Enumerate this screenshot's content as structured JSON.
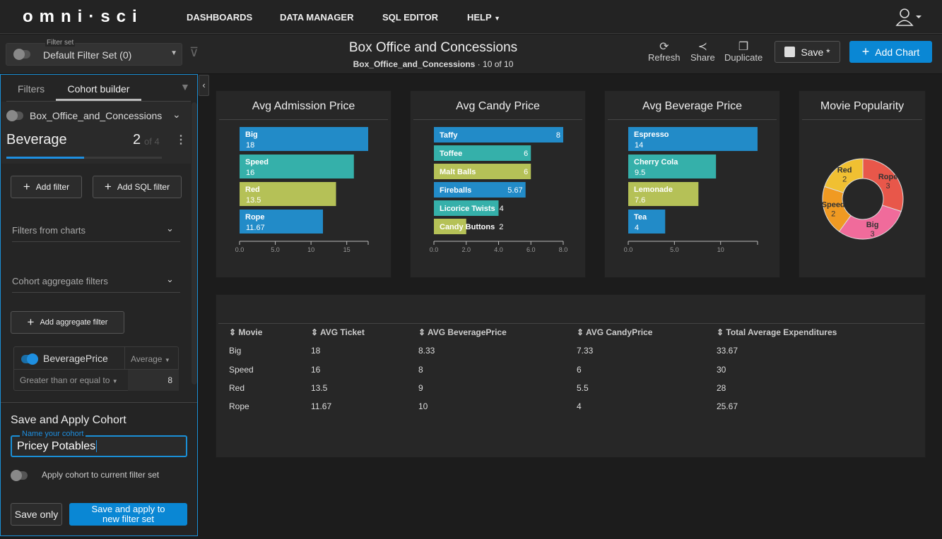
{
  "nav": {
    "logo": "omni·sci",
    "items": [
      "DASHBOARDS",
      "DATA MANAGER",
      "SQL EDITOR",
      "HELP"
    ],
    "user_icon": "user-icon"
  },
  "subheader": {
    "filter_set_label": "Filter set",
    "filter_set_value": "Default Filter Set (0)",
    "title": "Box Office and Concessions",
    "source": "Box_Office_and_Concessions",
    "count": "10 of 10",
    "refresh": "Refresh",
    "share": "Share",
    "duplicate": "Duplicate",
    "save": "Save *",
    "add_chart": "Add Chart"
  },
  "left": {
    "tabs": [
      "Filters",
      "Cohort builder"
    ],
    "active_tab": "Cohort builder",
    "table": "Box_Office_and_Concessions",
    "cohort": "Beverage",
    "index": "2",
    "of": "of 4",
    "progress": 0.5,
    "add_filter": "Add filter",
    "add_sql_filter": "Add SQL filter",
    "filters_from_charts": "Filters from charts",
    "cohort_aggregate_filters": "Cohort aggregate filters",
    "add_aggregate_filter": "Add aggregate filter",
    "agg": {
      "field": "BeveragePrice",
      "enabled": true,
      "agg": "Average",
      "op": "Greater than or equal to",
      "value": "8"
    },
    "save_title": "Save and Apply Cohort",
    "name_label": "Name your cohort",
    "name_value": "Pricey Potables",
    "apply_label": "Apply cohort to current filter set",
    "save_only": "Save only",
    "save_apply": "Save and apply to new filter set"
  },
  "colors": {
    "accent": "#0a87d4",
    "blue": "#228bc8",
    "teal": "#35b0aa",
    "olive": "#b5c157"
  },
  "chart_data": [
    {
      "type": "bar",
      "title": "Avg Admission Price",
      "categories": [
        "Big",
        "Speed",
        "Red",
        "Rope"
      ],
      "values": [
        18,
        16,
        13.5,
        11.67
      ],
      "labels": [
        "18",
        "16",
        "13.5",
        "11.67"
      ],
      "xticks": [
        "0.0",
        "5.0",
        "10",
        "15"
      ],
      "tickvals": [
        0,
        5,
        10,
        15
      ],
      "xlim": [
        0,
        18
      ],
      "colors": [
        "#228bc8",
        "#35b0aa",
        "#b5c157",
        "#228bc8"
      ]
    },
    {
      "type": "bar",
      "title": "Avg Candy Price",
      "categories": [
        "Taffy",
        "Toffee",
        "Malt Balls",
        "Fireballs",
        "Licorice Twists",
        "Candy Buttons"
      ],
      "values": [
        8,
        6,
        6,
        5.67,
        4,
        2
      ],
      "labels": [
        "8",
        "6",
        "6",
        "5.67",
        "4",
        "2"
      ],
      "xticks": [
        "0.0",
        "2.0",
        "4.0",
        "6.0",
        "8.0"
      ],
      "tickvals": [
        0,
        2,
        4,
        6,
        8
      ],
      "xlim": [
        0,
        8
      ],
      "colors": [
        "#228bc8",
        "#35b0aa",
        "#b5c157",
        "#228bc8",
        "#35b0aa",
        "#b5c157"
      ]
    },
    {
      "type": "bar",
      "title": "Avg Beverage Price",
      "categories": [
        "Espresso",
        "Cherry Cola",
        "Lemonade",
        "Tea"
      ],
      "values": [
        14,
        9.5,
        7.6,
        4
      ],
      "labels": [
        "14",
        "9.5",
        "7.6",
        "4"
      ],
      "xticks": [
        "0.0",
        "5.0",
        "10"
      ],
      "tickvals": [
        0,
        5,
        10
      ],
      "xlim": [
        0,
        14
      ],
      "colors": [
        "#228bc8",
        "#35b0aa",
        "#b5c157",
        "#228bc8"
      ]
    },
    {
      "type": "pie",
      "title": "Movie Popularity",
      "categories": [
        "Rope",
        "Big",
        "Speed",
        "Red"
      ],
      "values": [
        3,
        3,
        2,
        2
      ],
      "colors": [
        "#e8574a",
        "#f06b9b",
        "#f09a22",
        "#f0c032"
      ]
    }
  ],
  "table": {
    "columns": [
      "Movie",
      "AVG Ticket",
      "AVG BeveragePrice",
      "AVG CandyPrice",
      "Total Average Expenditures"
    ],
    "rows": [
      [
        "Big",
        "18",
        "8.33",
        "7.33",
        "33.67"
      ],
      [
        "Speed",
        "16",
        "8",
        "6",
        "30"
      ],
      [
        "Red",
        "13.5",
        "9",
        "5.5",
        "28"
      ],
      [
        "Rope",
        "11.67",
        "10",
        "4",
        "25.67"
      ]
    ]
  }
}
